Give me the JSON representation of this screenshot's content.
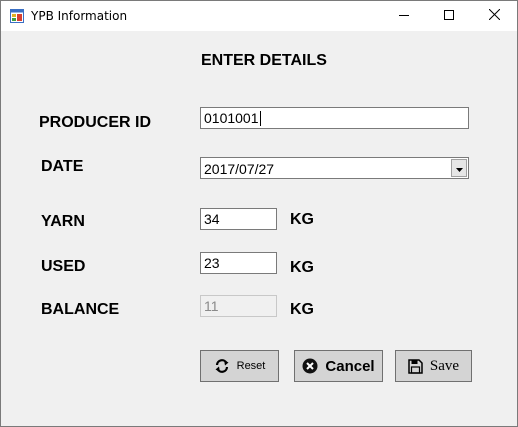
{
  "window": {
    "title": "YPB Information"
  },
  "form": {
    "heading": "ENTER DETAILS",
    "producer_id": {
      "label": "PRODUCER ID",
      "value": "0101001"
    },
    "date": {
      "label": "DATE",
      "value": "2017/07/27"
    },
    "yarn": {
      "label": "YARN",
      "value": "34",
      "unit": "KG"
    },
    "used": {
      "label": "USED",
      "value": "23",
      "unit": "KG"
    },
    "balance": {
      "label": "BALANCE",
      "value": "11",
      "unit": "KG"
    }
  },
  "buttons": {
    "reset": "Reset",
    "cancel": "Cancel",
    "save": "Save"
  },
  "icons": {
    "app": "app-window-icon",
    "reset": "refresh-icon",
    "cancel": "x-circle-icon",
    "save": "save-icon",
    "dropdown": "chevron-down-icon"
  },
  "colors": {
    "window_bg": "#f0f0f0",
    "button_bg": "#d4d4d4",
    "titlebar_bg": "#ffffff"
  }
}
